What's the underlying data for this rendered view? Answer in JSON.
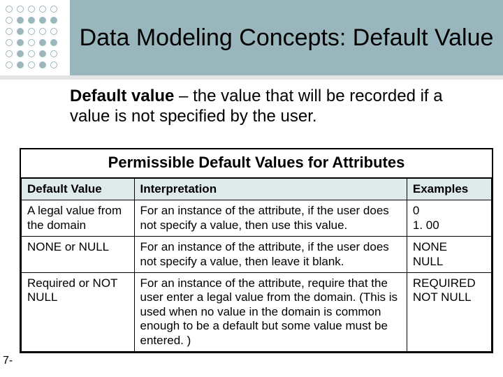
{
  "title": "Data Modeling Concepts: Default Value",
  "definition_term": "Default value",
  "definition_rest": " – the value that will be recorded if a value is not specified by the user.",
  "table_title": "Permissible Default Values for Attributes",
  "columns": {
    "c0": "Default Value",
    "c1": "Interpretation",
    "c2": "Examples"
  },
  "rows": [
    {
      "c0": "A legal value from the domain",
      "c1": "For an instance of the attribute, if the user does not specify a value, then use this value.",
      "c2": "0\n1. 00"
    },
    {
      "c0": "NONE or NULL",
      "c1": "For an instance of the attribute, if the user does not specify a value, then leave it blank.",
      "c2": "NONE\nNULL"
    },
    {
      "c0": "Required or NOT NULL",
      "c1": "For an instance of the attribute, require that the user enter a legal value from the domain. (This is used when no value in the domain is common enough to be a default but some value must be entered. )",
      "c2": "REQUIRED\nNOT NULL"
    }
  ],
  "slide_number": "7-"
}
